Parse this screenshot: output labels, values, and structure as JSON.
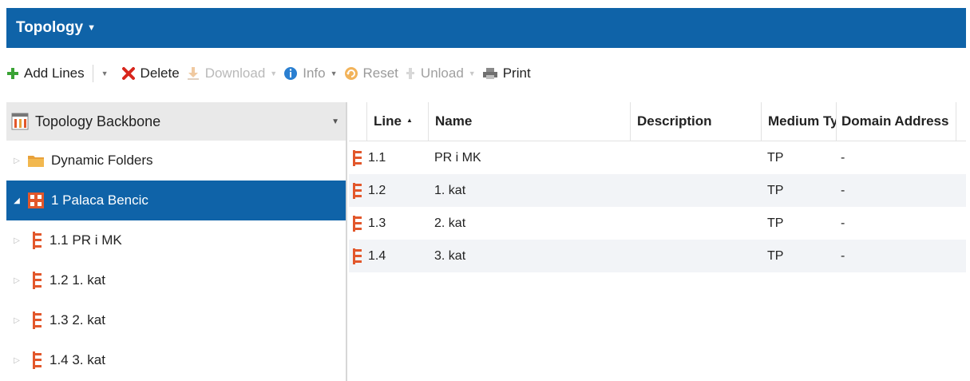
{
  "header": {
    "title": "Topology",
    "title_caret": "▼"
  },
  "toolbar": {
    "add_lines": "Add Lines",
    "delete": "Delete",
    "download": "Download",
    "info": "Info",
    "reset": "Reset",
    "unload": "Unload",
    "print": "Print",
    "dropdown_glyph": "▼"
  },
  "tree": {
    "header_label": "Topology Backbone",
    "header_dropdown": "▼",
    "collapsed_glyph": "▷",
    "expanded_glyph": "◢",
    "items": [
      {
        "label": "Dynamic Folders"
      },
      {
        "label": "1 Palaca Bencic"
      },
      {
        "label": "1.1 PR i MK"
      },
      {
        "label": "1.2 1. kat"
      },
      {
        "label": "1.3 2. kat"
      },
      {
        "label": "1.4 3. kat"
      }
    ]
  },
  "grid": {
    "columns": [
      "Line",
      "Name",
      "Description",
      "Medium Type",
      "Domain Address"
    ],
    "sort_indicator": "▲",
    "rows": [
      {
        "line": "1.1",
        "name": "PR i MK",
        "description": "",
        "medium": "TP",
        "domain": "-"
      },
      {
        "line": "1.2",
        "name": "1. kat",
        "description": "",
        "medium": "TP",
        "domain": "-"
      },
      {
        "line": "1.3",
        "name": "2. kat",
        "description": "",
        "medium": "TP",
        "domain": "-"
      },
      {
        "line": "1.4",
        "name": "3. kat",
        "description": "",
        "medium": "TP",
        "domain": "-"
      }
    ]
  },
  "colors": {
    "accent": "#0f63a8",
    "line_icon": "#e2572b",
    "folder": "#e8a13a",
    "add": "#3aa335",
    "delete": "#d8261c",
    "info": "#2a7fd1"
  }
}
